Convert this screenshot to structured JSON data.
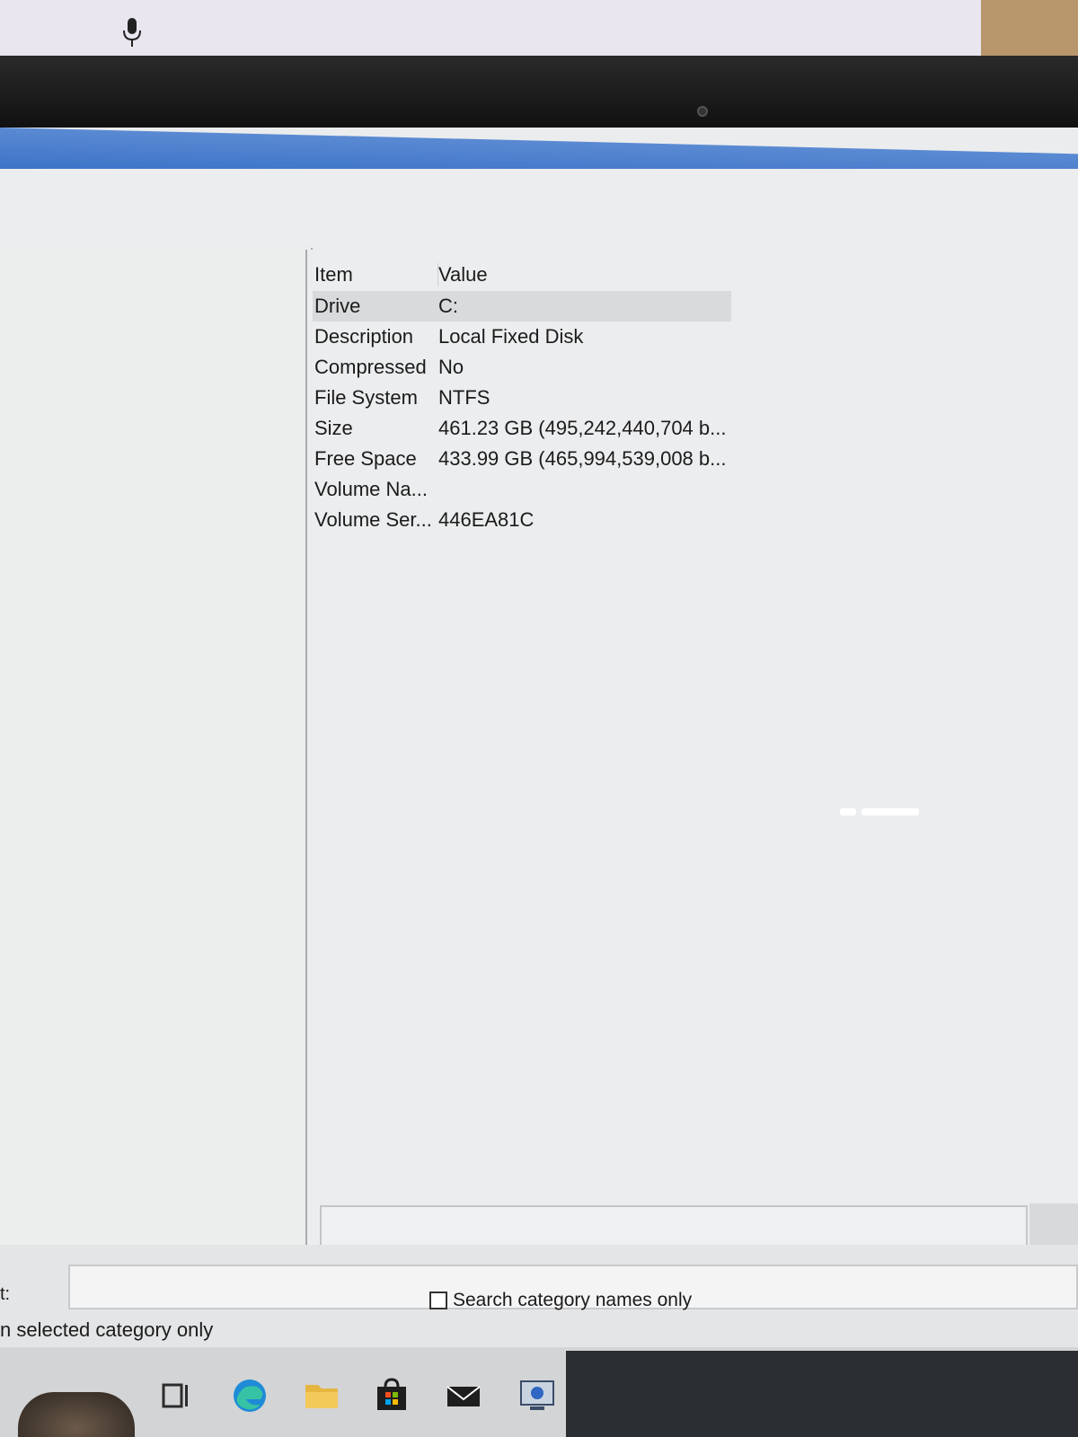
{
  "list": {
    "columns": {
      "item": "Item",
      "value": "Value"
    },
    "rows": [
      {
        "item": "Drive",
        "value": "C:"
      },
      {
        "item": "Description",
        "value": "Local Fixed Disk"
      },
      {
        "item": "Compressed",
        "value": "No"
      },
      {
        "item": "File System",
        "value": "NTFS"
      },
      {
        "item": "Size",
        "value": "461.23 GB (495,242,440,704 b..."
      },
      {
        "item": "Free Space",
        "value": "433.99 GB (465,994,539,008 b..."
      },
      {
        "item": "Volume Na...",
        "value": ""
      },
      {
        "item": "Volume Ser...",
        "value": "446EA81C"
      }
    ],
    "selected_index": 0
  },
  "search": {
    "label": "t:",
    "value": "",
    "selected_category_only": "n selected category only",
    "category_names_only": "Search category names only"
  },
  "taskbar": {
    "icons": [
      "task-view-icon",
      "edge-icon",
      "file-explorer-icon",
      "store-icon",
      "mail-icon",
      "system-information-icon"
    ]
  },
  "colors": {
    "title_bar": "#3d74c8",
    "window_bg": "#ecedee",
    "selection": "#d9dadb"
  }
}
